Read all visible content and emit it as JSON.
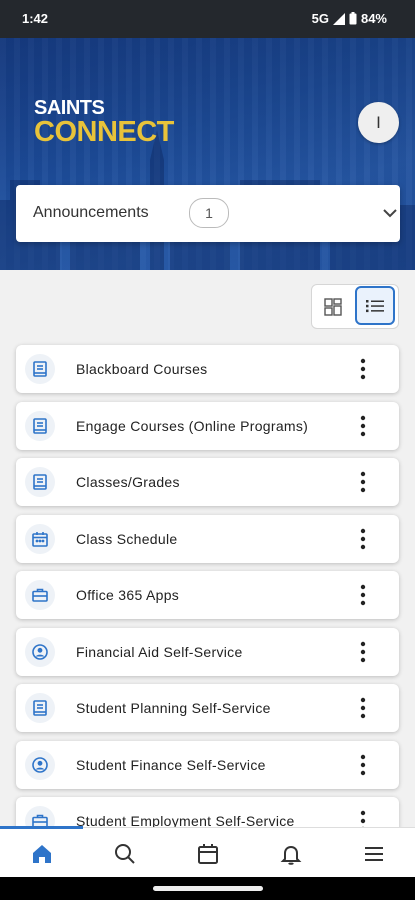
{
  "status_bar": {
    "time": "1:42",
    "network": "5G",
    "battery": "84%"
  },
  "header": {
    "logo_line1": "SAINTS",
    "logo_line2": "CONNECT",
    "avatar_initial": "I"
  },
  "announcements": {
    "label": "Announcements",
    "count": "1"
  },
  "colors": {
    "accent": "#2e74c9",
    "brand_gold": "#e8c33a",
    "hero_blue": "#1d4e9a"
  },
  "cards": [
    {
      "title": "Blackboard Courses",
      "icon": "book-icon"
    },
    {
      "title": "Engage Courses (Online Programs)",
      "icon": "book-icon"
    },
    {
      "title": "Classes/Grades",
      "icon": "book-icon"
    },
    {
      "title": "Class Schedule",
      "icon": "calendar-icon"
    },
    {
      "title": "Office 365 Apps",
      "icon": "briefcase-icon"
    },
    {
      "title": "Financial Aid Self-Service",
      "icon": "user-circle-icon"
    },
    {
      "title": "Student Planning Self-Service",
      "icon": "book-icon"
    },
    {
      "title": "Student Finance Self-Service",
      "icon": "user-circle-icon"
    },
    {
      "title": "Student Employment Self-Service",
      "icon": "briefcase-icon"
    }
  ],
  "bottom_nav": [
    {
      "name": "home-icon",
      "active": true
    },
    {
      "name": "search-icon",
      "active": false
    },
    {
      "name": "calendar-icon",
      "active": false
    },
    {
      "name": "bell-icon",
      "active": false
    },
    {
      "name": "menu-icon",
      "active": false
    }
  ]
}
